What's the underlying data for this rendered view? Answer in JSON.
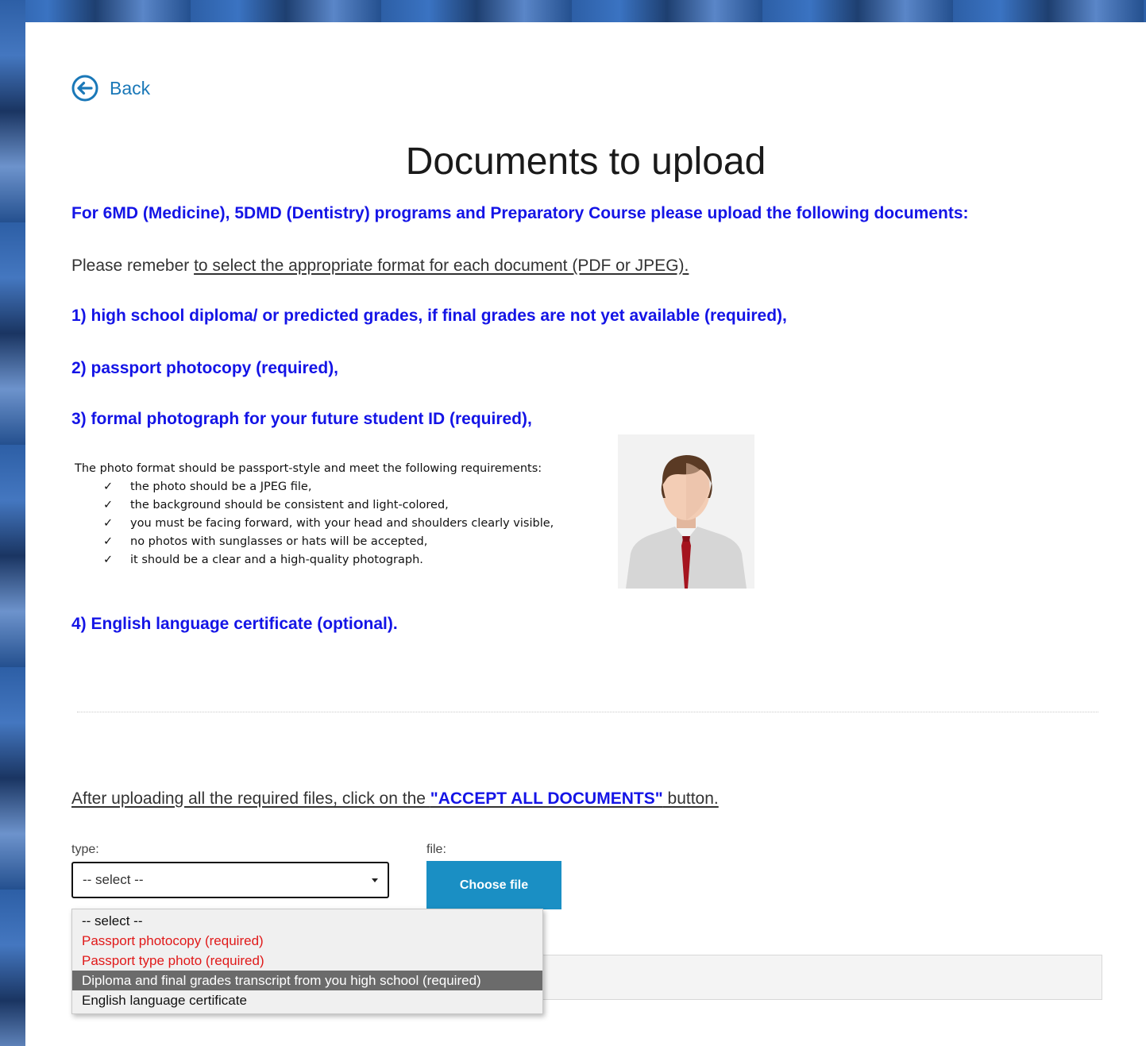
{
  "back": {
    "label": "Back"
  },
  "page_title": "Documents to upload",
  "intro": "For 6MD (Medicine), 5DMD (Dentistry) programs and Preparatory Course please upload the following documents:",
  "reminder": {
    "prefix": "Please remeber ",
    "underlined": "to select the appropriate format for each document (PDF or JPEG)."
  },
  "items": [
    "1) high school diploma/ or predicted grades, if final grades are not yet available (required),",
    "2) passport photocopy (required),",
    "3) formal photograph for your future student ID (required),",
    "4) English language certificate (optional)."
  ],
  "photo_requirements": {
    "heading": "The photo format should be passport-style and meet the following requirements:",
    "check_glyph": "✓",
    "list": [
      "the photo should be a JPEG file,",
      "the background should be consistent and light-colored,",
      "you must be facing forward, with your head and shoulders clearly visible,",
      "no photos with sunglasses or hats will be accepted,",
      "it should be a clear and a high-quality photograph."
    ]
  },
  "instruction": {
    "prefix": "After uploading all the required files, click on the ",
    "button_name": "\"ACCEPT ALL DOCUMENTS\"",
    "suffix": " button."
  },
  "form": {
    "type_label": "type:",
    "file_label": "file:",
    "selected_type": "-- select --",
    "choose_file_label": "Choose file",
    "options": [
      {
        "label": "-- select --",
        "style": "normal"
      },
      {
        "label": "Passport photocopy (required)",
        "style": "red"
      },
      {
        "label": "Passport type photo (required)",
        "style": "red"
      },
      {
        "label": "Diploma and final grades transcript from you high school (required)",
        "style": "highlighted"
      },
      {
        "label": "English language certificate",
        "style": "normal"
      }
    ]
  },
  "colors": {
    "heading_blue": "#1414e6",
    "link_blue": "#1a78b8",
    "button_blue": "#1a8fc4",
    "required_red": "#e01919",
    "highlight_gray": "#6b6b6b"
  },
  "icons": {
    "back": "circle-arrow-left-icon",
    "dropdown": "caret-down-icon",
    "check": "check-icon",
    "avatar": "person-avatar"
  }
}
